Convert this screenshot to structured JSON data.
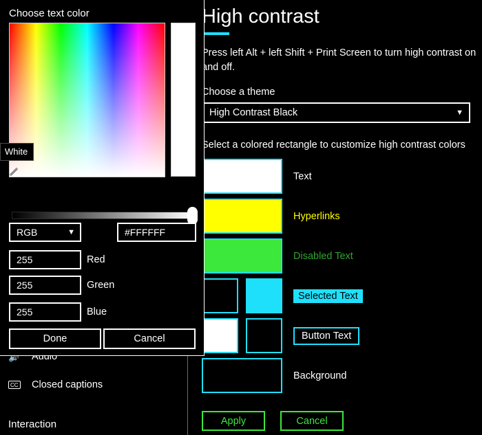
{
  "sidebar": {
    "items": [
      {
        "label": "Audio",
        "icon": "speaker-icon"
      },
      {
        "label": "Closed captions",
        "icon": "closed-captions-icon"
      }
    ],
    "section_header": "Interaction"
  },
  "page": {
    "title": "High contrast",
    "hint": "Press left Alt + left Shift + Print Screen to turn high contrast on and off.",
    "theme_label": "Choose a theme",
    "theme_value": "High Contrast Black",
    "customize_label": "Select a colored rectangle to customize high contrast colors",
    "apply_label": "Apply",
    "cancel_label": "Cancel",
    "accent_color": "#1FE0FB",
    "action_color": "#3BE83B"
  },
  "swatches": [
    {
      "label": "Text",
      "colors": [
        "#FFFFFF"
      ],
      "label_style": "plain",
      "label_color": "#FFFFFF"
    },
    {
      "label": "Hyperlinks",
      "colors": [
        "#FFFF00"
      ],
      "label_style": "plain",
      "label_color": "#FFFF00"
    },
    {
      "label": "Disabled Text",
      "colors": [
        "#3BE83B"
      ],
      "label_style": "plain",
      "label_color": "#2FA52F"
    },
    {
      "label": "Selected Text",
      "colors": [
        "#000000",
        "#1FE0FB"
      ],
      "label_style": "filled",
      "label_color": "#000000"
    },
    {
      "label": "Button Text",
      "colors": [
        "#FFFFFF",
        "#000000"
      ],
      "label_style": "boxed",
      "label_color": "#FFFFFF"
    },
    {
      "label": "Background",
      "colors": [
        "#000000"
      ],
      "label_style": "plain",
      "label_color": "#FFFFFF"
    }
  ],
  "dialog": {
    "title": "Choose text color",
    "tooltip": "White",
    "preview_color": "#FFFFFF",
    "mode": "RGB",
    "hex": "#FFFFFF",
    "channels": [
      {
        "value": "255",
        "label": "Red"
      },
      {
        "value": "255",
        "label": "Green"
      },
      {
        "value": "255",
        "label": "Blue"
      }
    ],
    "done_label": "Done",
    "cancel_label": "Cancel"
  }
}
